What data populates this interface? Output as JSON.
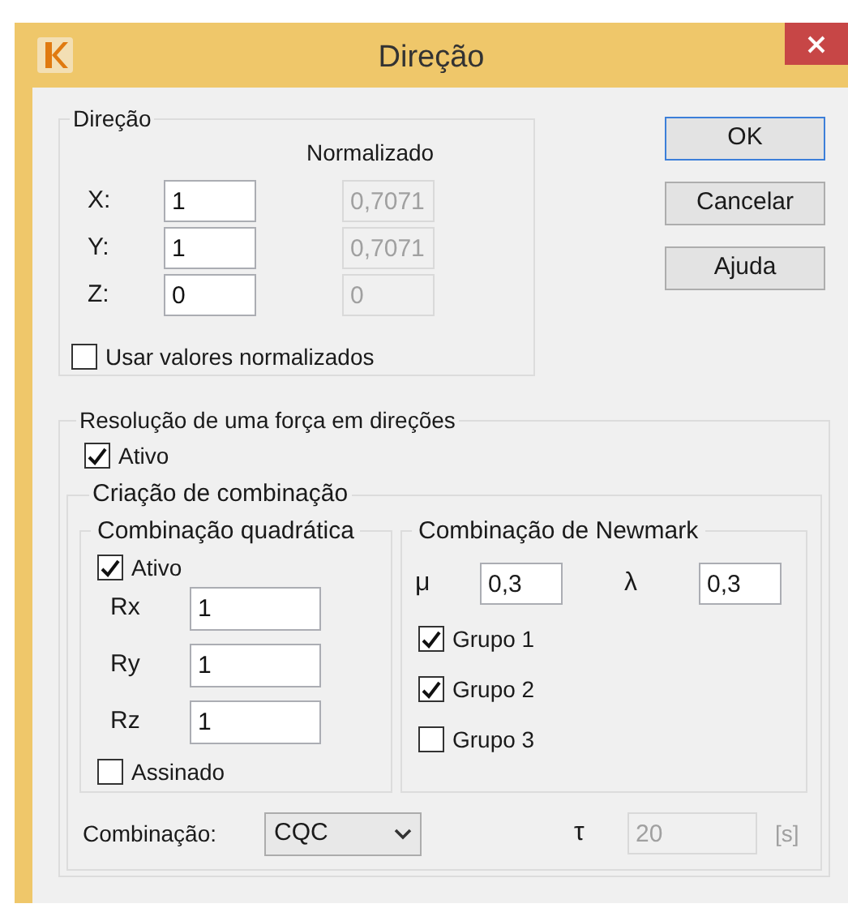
{
  "window": {
    "title": "Direção"
  },
  "direction": {
    "title": "Direção",
    "normalized_header": "Normalizado",
    "rows": [
      {
        "label": "X:",
        "value": "1",
        "normalized": "0,7071",
        "normalized_disabled": true
      },
      {
        "label": "Y:",
        "value": "1",
        "normalized": "0,7071",
        "normalized_disabled": true
      },
      {
        "label": "Z:",
        "value": "0",
        "normalized": "0",
        "normalized_disabled": true
      }
    ],
    "use_normalized": {
      "label": "Usar valores normalizados",
      "checked": false
    }
  },
  "buttons": [
    {
      "label": "OK",
      "default": true
    },
    {
      "label": "Cancelar",
      "default": false
    },
    {
      "label": "Ajuda",
      "default": false
    }
  ],
  "resolution": {
    "title": "Resolução de uma força em direções",
    "active": {
      "label": "Ativo",
      "checked": true
    },
    "creation": {
      "title": "Criação de combinação",
      "quadratic": {
        "title": "Combinação quadrática",
        "active": {
          "label": "Ativo",
          "checked": true
        },
        "rows": [
          {
            "label": "Rx",
            "value": "1"
          },
          {
            "label": "Ry",
            "value": "1"
          },
          {
            "label": "Rz",
            "value": "1"
          }
        ],
        "signed": {
          "label": "Assinado",
          "checked": false
        }
      },
      "newmark": {
        "title": "Combinação de Newmark",
        "mu": {
          "label": "μ",
          "value": "0,3"
        },
        "lambda": {
          "label": "λ",
          "value": "0,3"
        },
        "groups": [
          {
            "label": "Grupo 1",
            "checked": true
          },
          {
            "label": "Grupo 2",
            "checked": true
          },
          {
            "label": "Grupo 3",
            "checked": false
          }
        ]
      },
      "combination": {
        "label": "Combinação:",
        "value": "CQC"
      },
      "tau": {
        "label": "τ",
        "value": "20",
        "unit": "[s]",
        "disabled": true
      }
    }
  }
}
